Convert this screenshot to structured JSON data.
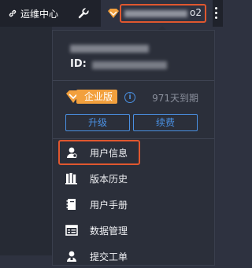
{
  "topbar": {
    "ops_center_label": "运维中心",
    "account_suffix": "o2",
    "colors": {
      "bar": "#1f222b",
      "highlight": "#e0572f"
    }
  },
  "profile": {
    "id_label": "ID:"
  },
  "edition": {
    "badge_label": "企业版",
    "expire_text": "971天到期",
    "upgrade_label": "升级",
    "renew_label": "续费",
    "colors": {
      "badge": "#f2a03d",
      "accent": "#4a90e2"
    }
  },
  "menu": {
    "items": [
      {
        "label": "用户信息",
        "icon": "user-icon"
      },
      {
        "label": "版本历史",
        "icon": "version-history-icon"
      },
      {
        "label": "用户手册",
        "icon": "manual-icon"
      },
      {
        "label": "数据管理",
        "icon": "data-management-icon"
      },
      {
        "label": "提交工单",
        "icon": "ticket-icon"
      }
    ]
  }
}
